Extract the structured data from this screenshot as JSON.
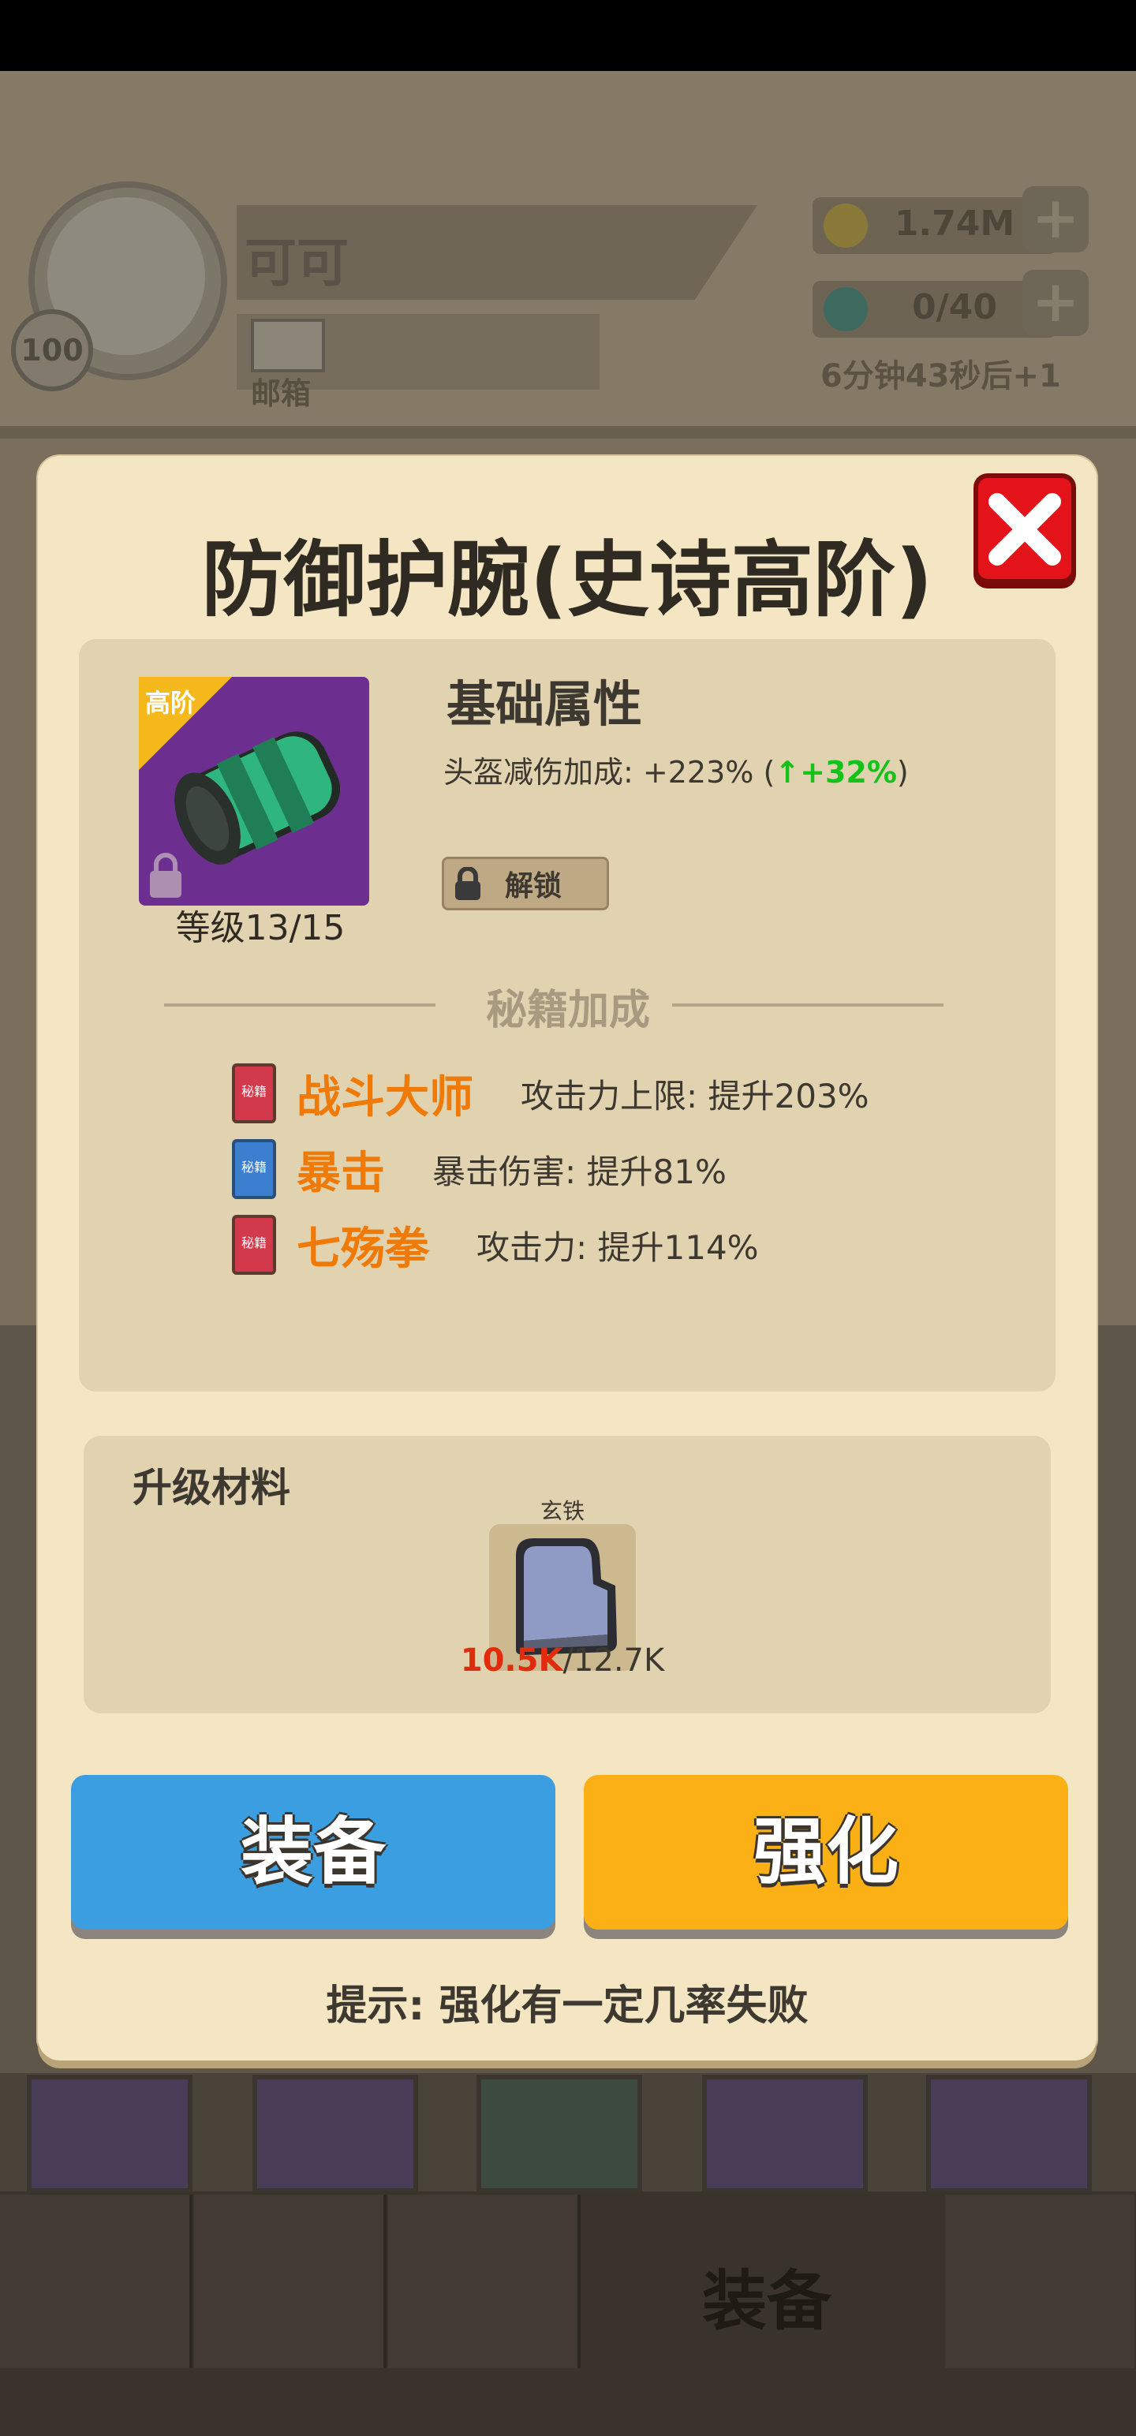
{
  "player": {
    "name": "可可",
    "level": "100",
    "mail_label": "邮箱"
  },
  "resources": {
    "gold": "1.74M",
    "energy": "0/40",
    "energy_timer": "6分钟43秒后+1"
  },
  "modal": {
    "title": "防御护腕(史诗高阶)",
    "item": {
      "tier_label": "高阶",
      "level_text": "等级13/15"
    },
    "attributes": {
      "title": "基础属性",
      "line_prefix": "头盔减伤加成: +223% (",
      "line_up": "↑+32%",
      "line_suffix": ")",
      "unlock_label": "解锁"
    },
    "skills_section_label": "秘籍加成",
    "skills": [
      {
        "book_text": "秘籍",
        "book_color": "#d23a4b",
        "name": "战斗大师",
        "desc": "攻击力上限: 提升203%"
      },
      {
        "book_text": "秘籍",
        "book_color": "#3c7fd1",
        "name": "暴击",
        "desc": "暴击伤害: 提升81%"
      },
      {
        "book_text": "秘籍",
        "book_color": "#d23a4b",
        "name": "七殇拳",
        "desc": "攻击力: 提升114%"
      }
    ],
    "materials": {
      "title": "升级材料",
      "item_name": "玄铁",
      "have": "10.5K",
      "need": "/12.7K"
    },
    "buttons": {
      "equip": "装备",
      "upgrade": "强化"
    },
    "hint": "提示: 强化有一定几率失败"
  },
  "background": {
    "slot_tag": "高阶",
    "nav_label": "装备"
  },
  "colors": {
    "equip_button": "#3a9ee1",
    "upgrade_button": "#fbb116",
    "close_button": "#e4131a",
    "skill_name": "#f07a07",
    "stat_up": "#14c31a"
  }
}
